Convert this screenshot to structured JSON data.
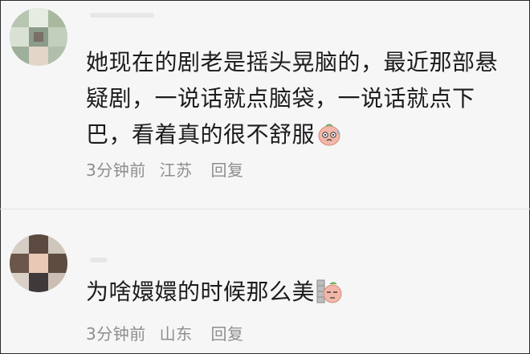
{
  "comments": [
    {
      "text": "她现在的剧老是摇头晃脑的，最近那部悬疑剧，一说话就点脑袋，一说话就点下巴，看着真的很不舒服",
      "emoji": "sweating-peach-emoji",
      "time": "3分钟前",
      "location": "江苏",
      "reply_label": "回复"
    },
    {
      "text": "为啥嬛嬛的时候那么美",
      "emoji": "wall-peeking-peach-emoji",
      "time": "3分钟前",
      "location": "山东",
      "reply_label": "回复"
    }
  ],
  "colors": {
    "background": "#f6f6f6",
    "text": "#1c1c1c",
    "meta": "#8e8e8e",
    "emoji_peach": "#f2b7a8"
  }
}
